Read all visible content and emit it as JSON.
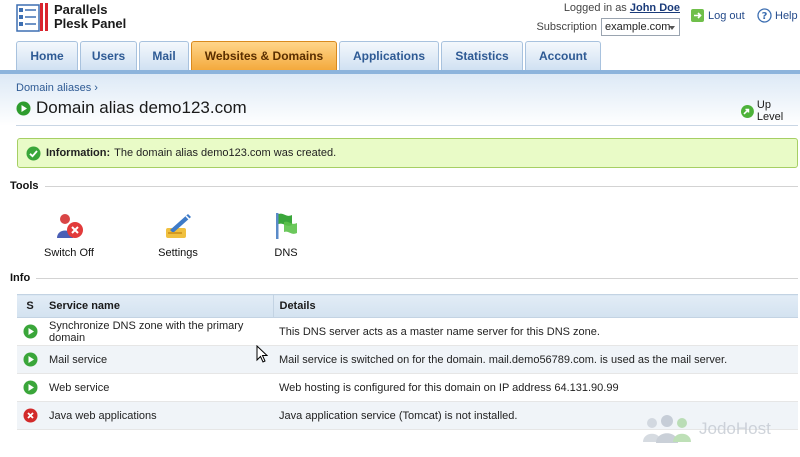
{
  "app": {
    "brand_line1": "Parallels",
    "brand_line2": "Plesk Panel"
  },
  "header": {
    "logged_in_prefix": "Logged in as",
    "user_name": "John Doe",
    "subscription_label": "Subscription",
    "subscription_value": "example.com",
    "logout_label": "Log out",
    "help_label": "Help"
  },
  "tabs": [
    {
      "label": "Home",
      "active": false
    },
    {
      "label": "Users",
      "active": false
    },
    {
      "label": "Mail",
      "active": false
    },
    {
      "label": "Websites & Domains",
      "active": true
    },
    {
      "label": "Applications",
      "active": false
    },
    {
      "label": "Statistics",
      "active": false
    },
    {
      "label": "Account",
      "active": false
    }
  ],
  "breadcrumb": {
    "item": "Domain aliases",
    "separator": "›"
  },
  "page": {
    "title": "Domain alias demo123.com",
    "up_level_label": "Up Level"
  },
  "message": {
    "label": "Information:",
    "text": "The domain alias demo123.com was created."
  },
  "tools": {
    "section_title": "Tools",
    "items": [
      {
        "label": "Switch Off",
        "icon": "switch-off-icon"
      },
      {
        "label": "Settings",
        "icon": "settings-icon"
      },
      {
        "label": "DNS",
        "icon": "dns-icon"
      }
    ]
  },
  "info": {
    "section_title": "Info",
    "columns": [
      "S",
      "Service name",
      "Details"
    ],
    "rows": [
      {
        "status": "ok",
        "service": "Synchronize DNS zone with the primary domain",
        "details": "This DNS server acts as a master name server for this DNS zone."
      },
      {
        "status": "ok",
        "service": "Mail service",
        "details": "Mail service is switched on for the domain. mail.demo56789.com. is used as the mail server."
      },
      {
        "status": "ok",
        "service": "Web service",
        "details": "Web hosting is configured for this domain on IP address 64.131.90.99"
      },
      {
        "status": "error",
        "service": "Java web applications",
        "details": "Java application service (Tomcat) is not installed."
      }
    ]
  },
  "watermark": {
    "text": "JodoHost"
  },
  "colors": {
    "tab_active": "#f3a83a",
    "tab_inactive": "#cfe0f2",
    "link": "#2e5a94",
    "status_ok": "#3aa63a",
    "status_error": "#d22a2a",
    "message_bg": "#e9fbc7"
  }
}
